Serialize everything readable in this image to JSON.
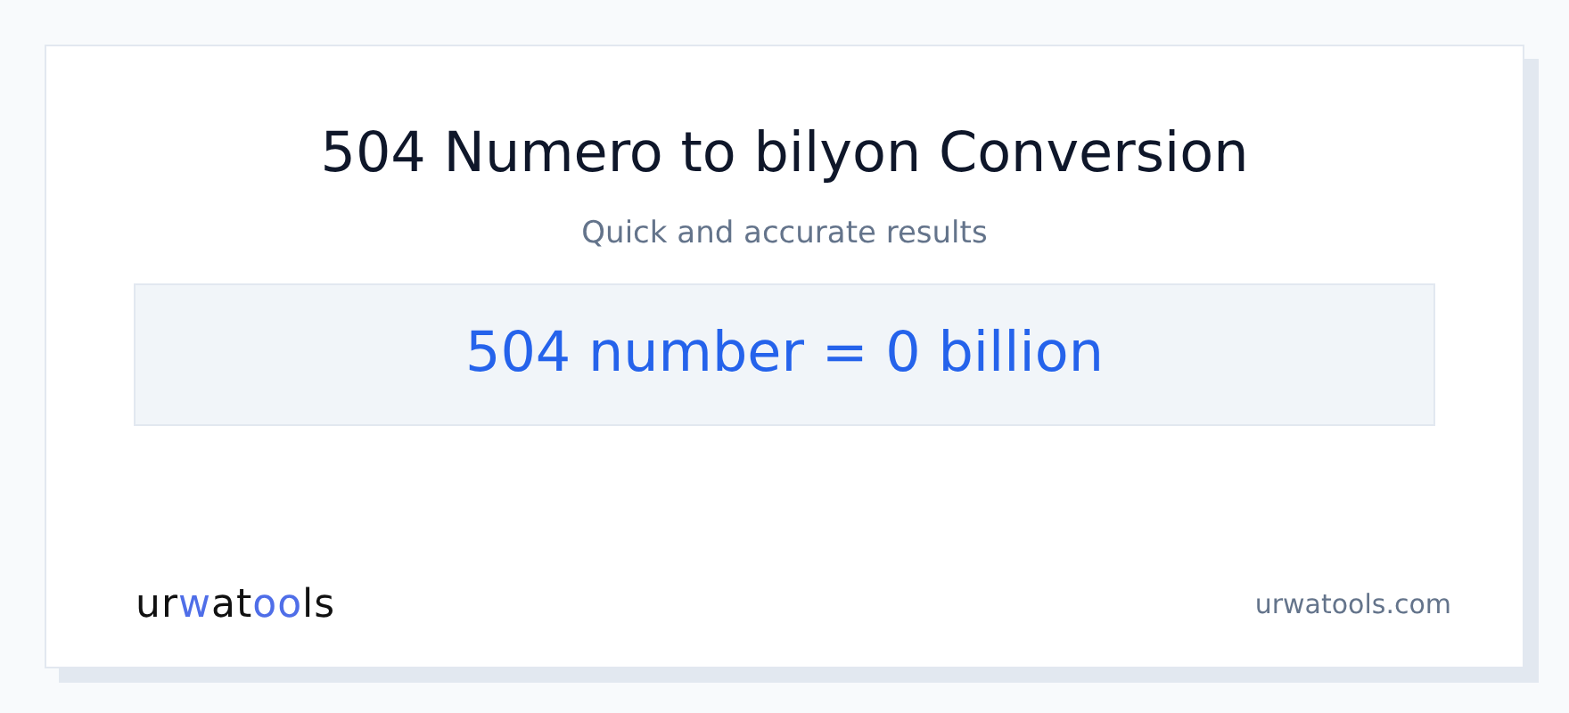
{
  "title": "504 Numero to bilyon Conversion",
  "subtitle": "Quick and accurate results",
  "result": "504 number = 0 billion",
  "logo": [
    {
      "text": "ur",
      "accent": false
    },
    {
      "text": "w",
      "accent": true
    },
    {
      "text": "at",
      "accent": false
    },
    {
      "text": "oo",
      "accent": true
    },
    {
      "text": "ls",
      "accent": false
    }
  ],
  "site": "urwatools.com"
}
